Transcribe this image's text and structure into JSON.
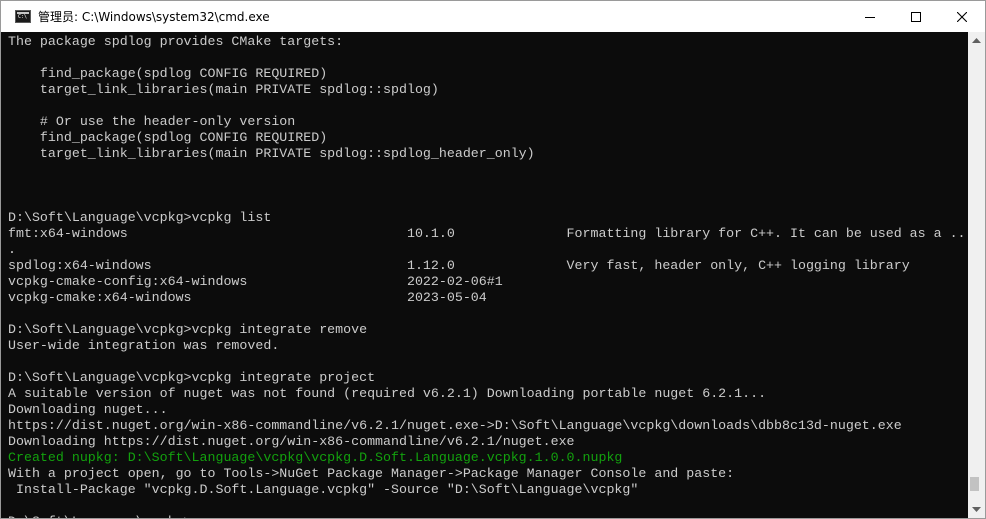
{
  "window": {
    "title": "管理员: C:\\Windows\\system32\\cmd.exe",
    "app_icon": "cmd-console-icon",
    "controls": {
      "minimize": "minimize-icon",
      "maximize": "maximize-icon",
      "close": "close-icon"
    }
  },
  "console": {
    "lines": [
      {
        "text": "The package spdlog provides CMake targets:",
        "color": "default"
      },
      {
        "text": "",
        "color": "default"
      },
      {
        "text": "    find_package(spdlog CONFIG REQUIRED)",
        "color": "default"
      },
      {
        "text": "    target_link_libraries(main PRIVATE spdlog::spdlog)",
        "color": "default"
      },
      {
        "text": "",
        "color": "default"
      },
      {
        "text": "    # Or use the header-only version",
        "color": "default"
      },
      {
        "text": "    find_package(spdlog CONFIG REQUIRED)",
        "color": "default"
      },
      {
        "text": "    target_link_libraries(main PRIVATE spdlog::spdlog_header_only)",
        "color": "default"
      },
      {
        "text": "",
        "color": "default"
      },
      {
        "text": "",
        "color": "default"
      },
      {
        "text": "",
        "color": "default"
      },
      {
        "text": "D:\\Soft\\Language\\vcpkg>vcpkg list",
        "color": "default"
      },
      {
        "text": "fmt:x64-windows                                   10.1.0              Formatting library for C++. It can be used as a ..",
        "color": "default"
      },
      {
        "text": ".",
        "color": "default"
      },
      {
        "text": "spdlog:x64-windows                                1.12.0              Very fast, header only, C++ logging library",
        "color": "default"
      },
      {
        "text": "vcpkg-cmake-config:x64-windows                    2022-02-06#1",
        "color": "default"
      },
      {
        "text": "vcpkg-cmake:x64-windows                           2023-05-04",
        "color": "default"
      },
      {
        "text": "",
        "color": "default"
      },
      {
        "text": "D:\\Soft\\Language\\vcpkg>vcpkg integrate remove",
        "color": "default"
      },
      {
        "text": "User-wide integration was removed.",
        "color": "default"
      },
      {
        "text": "",
        "color": "default"
      },
      {
        "text": "D:\\Soft\\Language\\vcpkg>vcpkg integrate project",
        "color": "default"
      },
      {
        "text": "A suitable version of nuget was not found (required v6.2.1) Downloading portable nuget 6.2.1...",
        "color": "default"
      },
      {
        "text": "Downloading nuget...",
        "color": "default"
      },
      {
        "text": "https://dist.nuget.org/win-x86-commandline/v6.2.1/nuget.exe->D:\\Soft\\Language\\vcpkg\\downloads\\dbb8c13d-nuget.exe",
        "color": "default"
      },
      {
        "text": "Downloading https://dist.nuget.org/win-x86-commandline/v6.2.1/nuget.exe",
        "color": "default"
      },
      {
        "text": "Created nupkg: D:\\Soft\\Language\\vcpkg\\vcpkg.D.Soft.Language.vcpkg.1.0.0.nupkg",
        "color": "green"
      },
      {
        "text": "With a project open, go to Tools->NuGet Package Manager->Package Manager Console and paste:",
        "color": "default"
      },
      {
        "text": " Install-Package \"vcpkg.D.Soft.Language.vcpkg\" -Source \"D:\\Soft\\Language\\vcpkg\"",
        "color": "default"
      },
      {
        "text": "",
        "color": "default"
      },
      {
        "text": "D:\\Soft\\Language\\vcpkg>",
        "color": "default",
        "cursor": true
      }
    ]
  },
  "colors": {
    "console_background": "#0c0c0c",
    "default_text": "#cccccc",
    "green_text": "#13a10e",
    "titlebar": "#ffffff",
    "scrollbar_track": "#f0f0f0",
    "scrollbar_thumb": "#c2c2c2"
  },
  "scrollbar": {
    "up_arrow": "scroll-up-arrow-icon",
    "down_arrow": "scroll-down-arrow-icon",
    "position": 1.0
  }
}
